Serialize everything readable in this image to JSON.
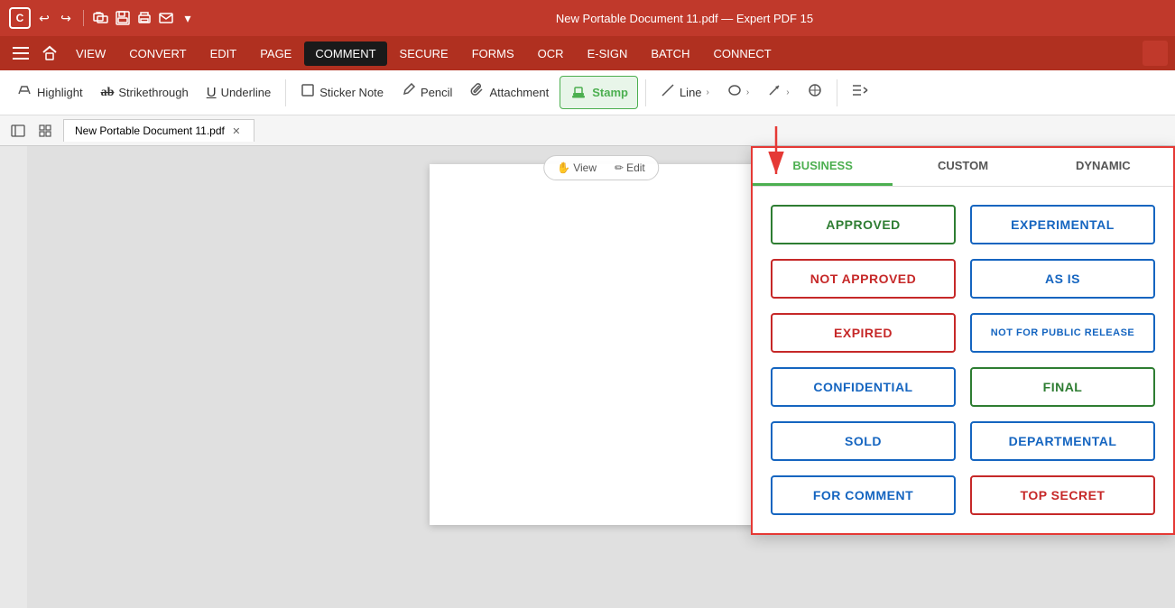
{
  "titleBar": {
    "appLogo": "C",
    "docTitle": "New Portable Document 11.pdf  —  Expert PDF 15",
    "undoIcon": "↩",
    "redoIcon": "↪",
    "openIcon": "📂",
    "saveIcon": "💾",
    "printIcon": "🖨",
    "emailIcon": "✉",
    "moreIcon": "▾"
  },
  "menuBar": {
    "hamburger": "☰",
    "homeIcon": "⌂",
    "items": [
      {
        "label": "VIEW",
        "active": false
      },
      {
        "label": "CONVERT",
        "active": false
      },
      {
        "label": "EDIT",
        "active": false
      },
      {
        "label": "PAGE",
        "active": false
      },
      {
        "label": "COMMENT",
        "active": true
      },
      {
        "label": "SECURE",
        "active": false
      },
      {
        "label": "FORMS",
        "active": false
      },
      {
        "label": "OCR",
        "active": false
      },
      {
        "label": "E-SIGN",
        "active": false
      },
      {
        "label": "BATCH",
        "active": false
      },
      {
        "label": "CONNECT",
        "active": false
      }
    ]
  },
  "toolbar": {
    "items": [
      {
        "label": "Highlight",
        "icon": "✏",
        "name": "highlight-tool"
      },
      {
        "label": "Strikethrough",
        "icon": "ab̶",
        "name": "strikethrough-tool"
      },
      {
        "label": "Underline",
        "icon": "U̲",
        "name": "underline-tool"
      },
      {
        "label": "Sticker Note",
        "icon": "□",
        "name": "sticker-note-tool"
      },
      {
        "label": "Pencil",
        "icon": "✏",
        "name": "pencil-tool"
      },
      {
        "label": "Attachment",
        "icon": "📎",
        "name": "attachment-tool"
      },
      {
        "label": "Stamp",
        "icon": "⬆",
        "name": "stamp-tool",
        "active": true
      },
      {
        "label": "Line",
        "icon": "/",
        "name": "line-tool"
      },
      {
        "label": "Oval",
        "icon": "○",
        "name": "oval-tool"
      },
      {
        "label": "Arrow",
        "icon": "↗",
        "name": "arrow-tool"
      },
      {
        "label": "Measure",
        "icon": "⊕",
        "name": "measure-tool"
      },
      {
        "label": "More",
        "icon": "⇄",
        "name": "more-tool"
      }
    ]
  },
  "tabBar": {
    "docName": "New Portable Document 11.pdf",
    "closeBtn": "✕"
  },
  "viewEditBar": {
    "viewLabel": "View",
    "editLabel": "Edit",
    "viewIcon": "✋",
    "editIcon": "✏"
  },
  "stampPopup": {
    "tabs": [
      {
        "label": "BUSINESS",
        "active": true
      },
      {
        "label": "CUSTOM",
        "active": false
      },
      {
        "label": "DYNAMIC",
        "active": false
      }
    ],
    "stamps": [
      {
        "label": "APPROVED",
        "color": "green",
        "name": "approved-stamp"
      },
      {
        "label": "EXPERIMENTAL",
        "color": "blue",
        "name": "experimental-stamp"
      },
      {
        "label": "NOT APPROVED",
        "color": "red",
        "name": "not-approved-stamp"
      },
      {
        "label": "AS IS",
        "color": "blue",
        "name": "as-is-stamp"
      },
      {
        "label": "EXPIRED",
        "color": "red",
        "name": "expired-stamp"
      },
      {
        "label": "NOT FOR PUBLIC RELEASE",
        "color": "blue",
        "name": "not-for-public-release-stamp"
      },
      {
        "label": "CONFIDENTIAL",
        "color": "blue",
        "name": "confidential-stamp"
      },
      {
        "label": "FINAL",
        "color": "green",
        "name": "final-stamp"
      },
      {
        "label": "SOLD",
        "color": "blue",
        "name": "sold-stamp"
      },
      {
        "label": "DEPARTMENTAL",
        "color": "blue",
        "name": "departmental-stamp"
      },
      {
        "label": "FOR COMMENT",
        "color": "blue",
        "name": "for-comment-stamp"
      },
      {
        "label": "TOP SECRET",
        "color": "red",
        "name": "top-secret-stamp"
      }
    ]
  }
}
